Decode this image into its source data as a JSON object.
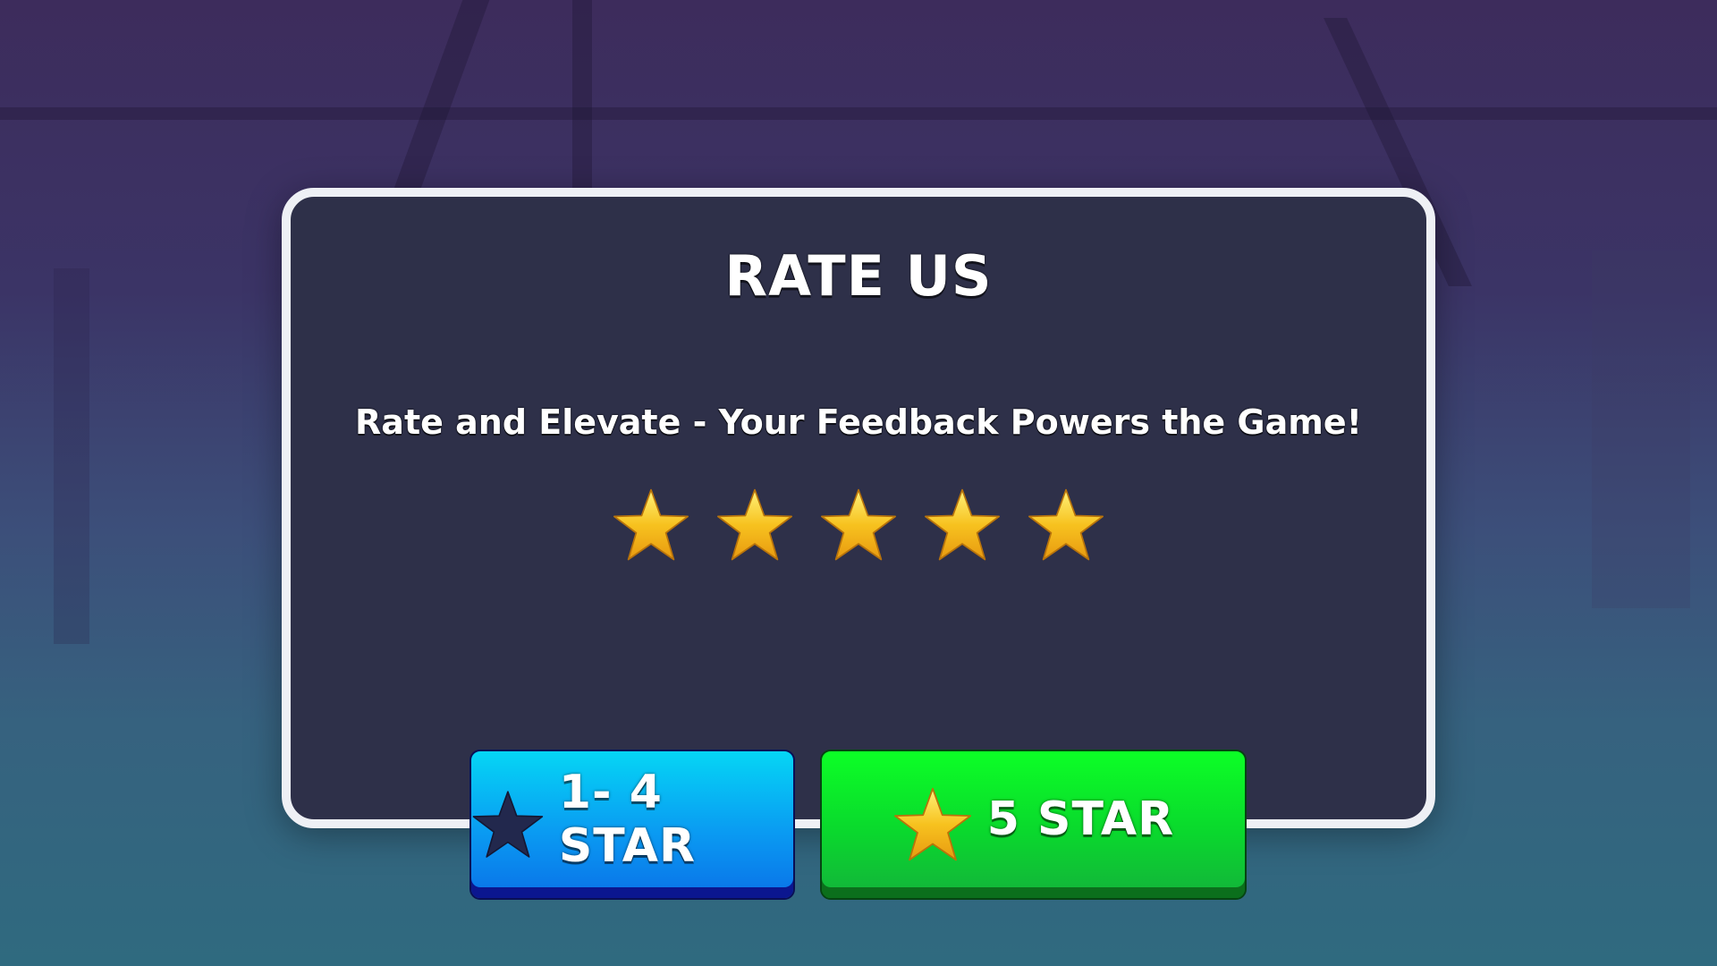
{
  "dialog": {
    "title": "RATE US",
    "subtitle": "Rate and Elevate - Your Feedback Powers the Game!"
  },
  "rating": {
    "selected": 5,
    "max": 5,
    "star_color": "#f7c21f"
  },
  "buttons": {
    "low_label": "1- 4 STAR",
    "high_label": "5 STAR",
    "low_color": "#0a9bf2",
    "high_color": "#0ad82d",
    "low_icon": "star-dark-icon",
    "high_icon": "star-gold-icon"
  }
}
